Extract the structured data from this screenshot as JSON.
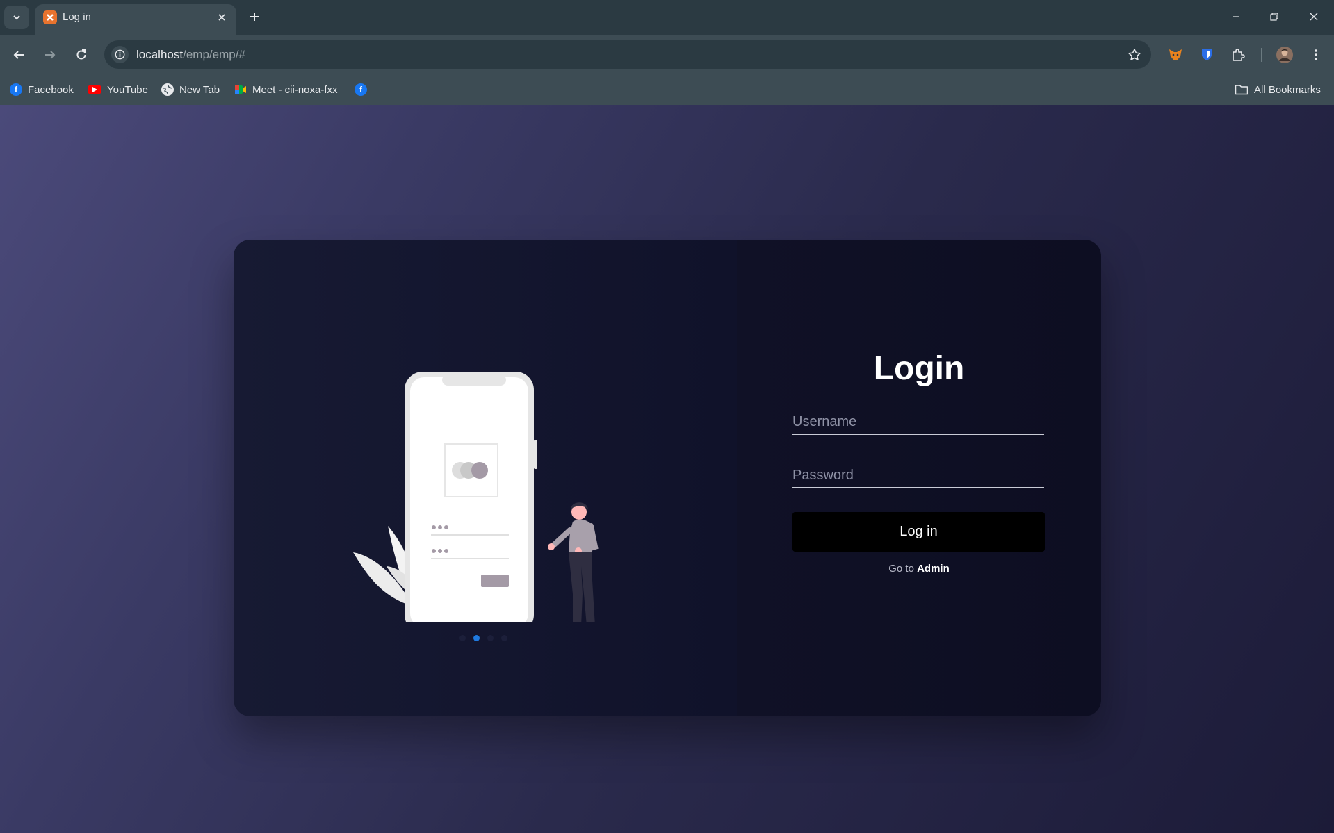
{
  "browser": {
    "tab": {
      "title": "Log in"
    },
    "address": {
      "host": "localhost",
      "path": "/emp/emp/#"
    },
    "bookmarks": [
      {
        "label": "Facebook",
        "icon": "facebook-icon"
      },
      {
        "label": "YouTube",
        "icon": "youtube-icon"
      },
      {
        "label": "New Tab",
        "icon": "globe-icon"
      },
      {
        "label": "Meet - cii-noxa-fxx",
        "icon": "meet-icon"
      }
    ],
    "all_bookmarks_label": "All Bookmarks"
  },
  "login": {
    "title": "Login",
    "username_placeholder": "Username",
    "password_placeholder": "Password",
    "submit_label": "Log in",
    "goto_prefix": "Go to",
    "goto_link": "Admin"
  },
  "carousel": {
    "slide_count": 4,
    "active_index": 1
  },
  "colors": {
    "page_bg_start": "#4b4a7a",
    "page_bg_end": "#1c1b38",
    "card_bg": "#14162c",
    "accent": "#1f7ae0",
    "button_bg": "#000000"
  }
}
